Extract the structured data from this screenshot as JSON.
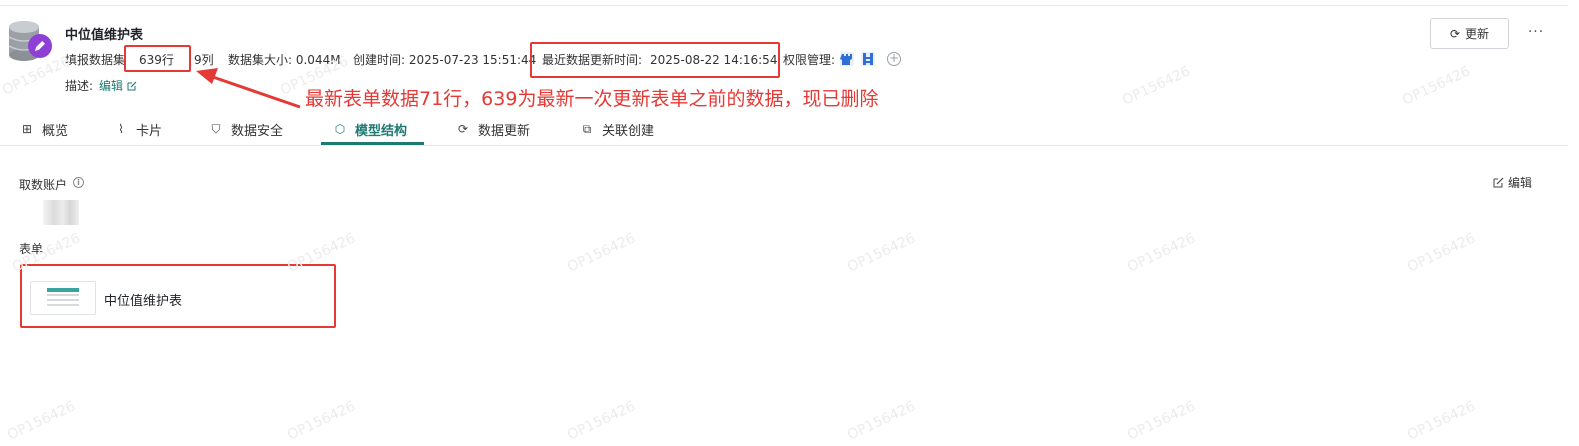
{
  "header": {
    "title": "中位值维护表",
    "meta": {
      "rows_label": "填报数据集",
      "rows": "639行",
      "cols": "9列",
      "size": "数据集大小: 0.044M",
      "created": "创建时间: 2025-07-23 15:51:44",
      "last_update_label": "最近数据更新时间:",
      "last_update_value": "2025-08-22 14:16:54",
      "permission": "权限管理:"
    },
    "desc_label": "描述:",
    "desc_edit": "编辑",
    "update_button": "更新",
    "more_button": "···"
  },
  "annotation": {
    "text": "最新表单数据71行，639为最新一次更新表单之前的数据，现已删除",
    "color": "#e53935"
  },
  "tabs": [
    {
      "label": "概览",
      "icon": "table-icon"
    },
    {
      "label": "卡片",
      "icon": "chart-icon"
    },
    {
      "label": "数据安全",
      "icon": "shield-icon"
    },
    {
      "label": "模型结构",
      "icon": "cube-icon",
      "active": true
    },
    {
      "label": "数据更新",
      "icon": "refresh-icon"
    },
    {
      "label": "关联创建",
      "icon": "link-icon"
    }
  ],
  "content": {
    "account_label": "取数账户",
    "edit_label": "编辑",
    "form_label": "表单",
    "form_name": "中位值维护表"
  },
  "watermark": "OP156426",
  "colors": {
    "accent": "#1f7a73",
    "annotation": "#e53935"
  }
}
